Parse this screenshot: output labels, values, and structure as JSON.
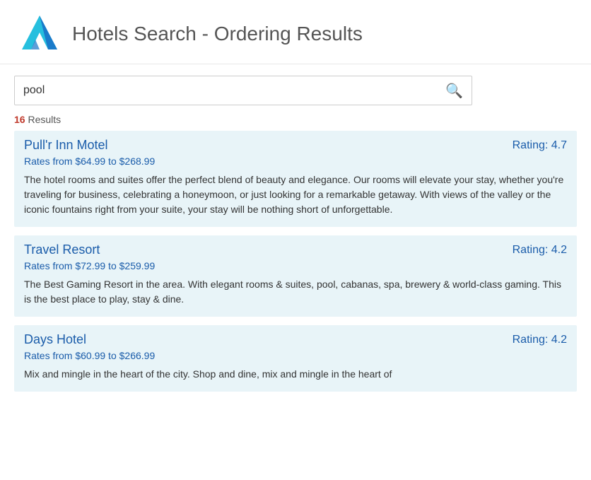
{
  "header": {
    "title": "Hotels Search - Ordering Results"
  },
  "search": {
    "placeholder": "pool",
    "value": "pool",
    "icon": "🔍"
  },
  "results": {
    "count": "16",
    "label": " Results"
  },
  "hotels": [
    {
      "name": "Pull'r Inn Motel",
      "rating": "Rating: 4.7",
      "rates": "Rates from $64.99 to $268.99",
      "description": "The hotel rooms and suites offer the perfect blend of beauty and elegance. Our rooms will elevate your stay, whether you're traveling for business, celebrating a honeymoon, or just looking for a remarkable getaway. With views of the valley or the iconic fountains right from your suite, your stay will be nothing short of unforgettable."
    },
    {
      "name": "Travel Resort",
      "rating": "Rating: 4.2",
      "rates": "Rates from $72.99 to $259.99",
      "description": "The Best Gaming Resort in the area.  With elegant rooms & suites, pool, cabanas, spa, brewery & world-class gaming.  This is the best place to play, stay & dine."
    },
    {
      "name": "Days Hotel",
      "rating": "Rating: 4.2",
      "rates": "Rates from $60.99 to $266.99",
      "description": "Mix and mingle in the heart of the city. Shop and dine, mix and mingle in the heart of"
    }
  ]
}
